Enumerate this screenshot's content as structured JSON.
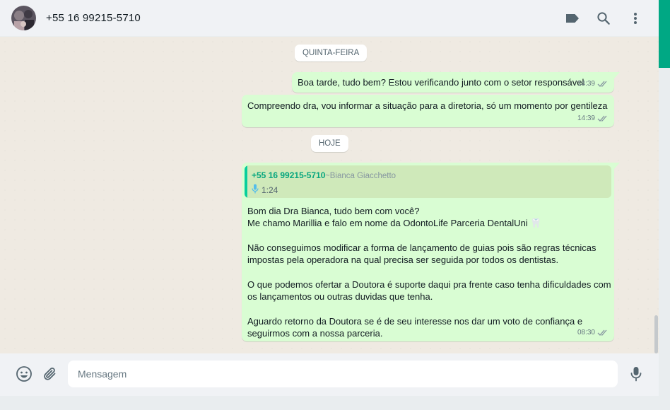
{
  "header": {
    "contact": "+55 16 99215-5710",
    "icons": [
      "label-icon",
      "search-icon",
      "menu-icon"
    ]
  },
  "conversation": {
    "day_1": "QUINTA-FEIRA",
    "msg_1": {
      "text": "Boa tarde, tudo bem? Estou verificando junto com o setor responsável",
      "time": "14:39"
    },
    "msg_2": {
      "text": "Compreendo dra, vou informar a situação para a diretoria, só um momento por gentileza",
      "time": "14:39"
    },
    "day_2": "HOJE",
    "msg_3": {
      "quote": {
        "author": "+55 16 99215-5710",
        "pushname": "~Bianca Giacchetto",
        "duration": "1:24"
      },
      "lines": [
        "Bom dia Dra Bianca, tudo bem com você?",
        "Me chamo Marillia e falo em nome da OdontoLife Parceria DentalUni 🦷",
        "Não conseguimos modificar a forma de lançamento de guias pois são regras técnicas",
        "impostas pela operadora na qual precisa ser seguida por todos os dentistas.",
        "O que podemos ofertar a Doutora é suporte daqui pra frente caso tenha dificuldades com",
        "os lançamentos ou outras duvidas que tenha.",
        "Aguardo retorno da Doutora se é de seu interesse nos dar um voto de confiança e",
        "seguirmos com a nossa parceria."
      ],
      "time": "08:30"
    }
  },
  "footer": {
    "placeholder": "Mensagem",
    "icons": [
      "emoji-icon",
      "attach-icon",
      "mic-icon"
    ]
  },
  "colors": {
    "outgoing_bubble": "#d9fdd3",
    "accent": "#00a884",
    "read_ticks": "#8696a0"
  }
}
